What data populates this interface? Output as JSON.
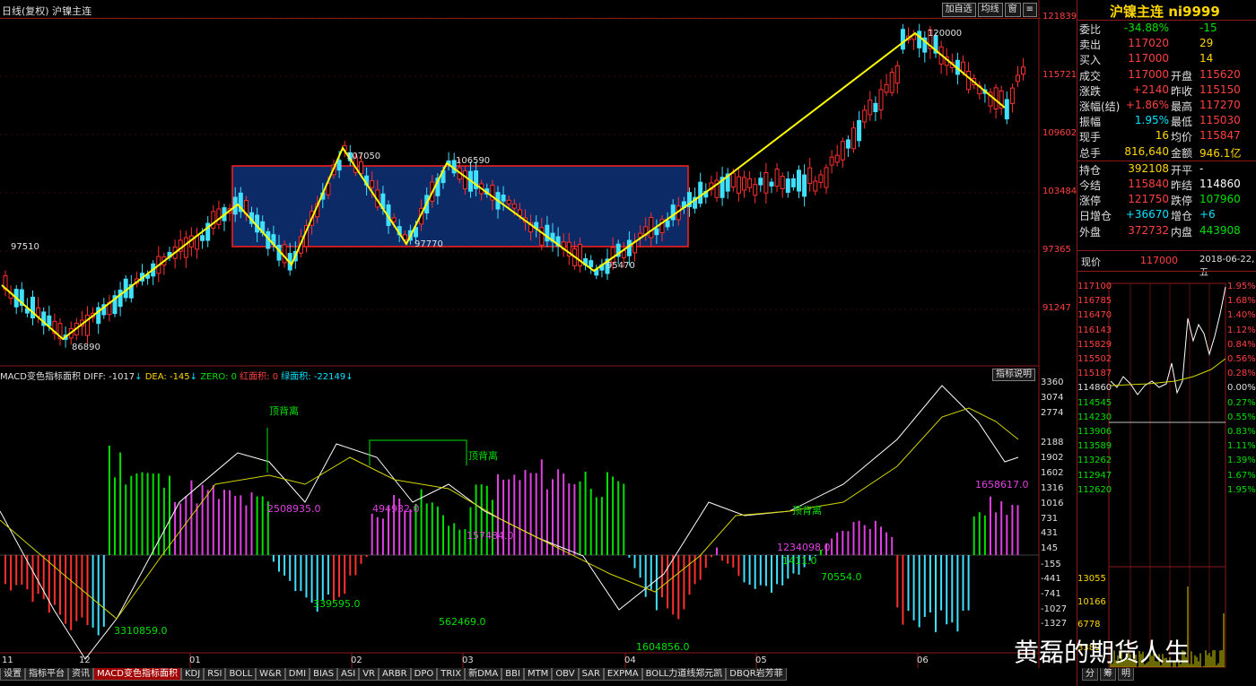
{
  "topbar": {
    "title": "日线(复权)  沪镍主连",
    "buttons": [
      "加自选",
      "均线",
      "窗",
      "≡"
    ]
  },
  "price_axis": [
    "121839",
    "115721",
    "109602",
    "103484",
    "97365",
    "91247"
  ],
  "price_annotations": [
    {
      "text": "97510"
    },
    {
      "text": "86890"
    },
    {
      "text": "107050"
    },
    {
      "text": "97770"
    },
    {
      "text": "106590"
    },
    {
      "text": "95470"
    },
    {
      "text": "120000"
    }
  ],
  "macd_header": {
    "name": "MACD变色指标面积",
    "diff": "DIFF: -1017",
    "dea": "DEA: -145",
    "zero": "ZERO: 0",
    "red_area": "红面积: 0",
    "green_area": "绿面积: -22149"
  },
  "macd_help_button": "指标说明",
  "macd_axis": [
    "3360",
    "3074",
    "2774",
    "2188",
    "1902",
    "1602",
    "1316",
    "1016",
    "731",
    "431",
    "145",
    "-155",
    "-441",
    "-741",
    "-1027",
    "-1327"
  ],
  "macd_labels": [
    {
      "text": "顶背离",
      "color": "#00e000"
    },
    {
      "text": "顶背离",
      "color": "#00e000"
    },
    {
      "text": "顶背离",
      "color": "#00e000"
    },
    {
      "text": "2508935.0",
      "color": "#e040e0"
    },
    {
      "text": "494932.0",
      "color": "#e040e0"
    },
    {
      "text": "157484.0",
      "color": "#e040e0"
    },
    {
      "text": "1658617.0",
      "color": "#e040e0"
    },
    {
      "text": "1234098.0",
      "color": "#e040e0"
    },
    {
      "text": "1411.0",
      "color": "#00e000"
    },
    {
      "text": "70554.0",
      "color": "#00e000"
    },
    {
      "text": "339595.0",
      "color": "#00e000"
    },
    {
      "text": "562469.0",
      "color": "#00e000"
    },
    {
      "text": "1604856.0",
      "color": "#00e000"
    },
    {
      "text": "3310859.0",
      "color": "#00e000"
    }
  ],
  "months": [
    "11",
    "12",
    "01",
    "02",
    "03",
    "04",
    "05",
    "06"
  ],
  "tabs": [
    "设置",
    "指标平台",
    "资讯",
    "MACD变色指标面积",
    "KDJ",
    "RSI",
    "BOLL",
    "W&R",
    "DMI",
    "BIAS",
    "ASI",
    "VR",
    "ARBR",
    "DPO",
    "TRIX",
    "新DMA",
    "BBI",
    "MTM",
    "OBV",
    "SAR",
    "EXPMA",
    "BOLL力道线郑元凯",
    "DBQR岩芳菲"
  ],
  "active_tab": "MACD变色指标面积",
  "quote": {
    "title": "沪镍主连 ni9999",
    "rows": [
      {
        "l1": "委比",
        "v1": "-34.88%",
        "c1": "grn",
        "l2": "",
        "v2": "-15",
        "c2": "grn"
      },
      {
        "l1": "卖出",
        "v1": "117020",
        "c1": "red",
        "l2": "",
        "v2": "29",
        "c2": "yel"
      },
      {
        "l1": "买入",
        "v1": "117000",
        "c1": "red",
        "l2": "",
        "v2": "14",
        "c2": "yel"
      },
      {
        "l1": "成交",
        "v1": "117000",
        "c1": "red",
        "l2": "开盘",
        "v2": "115620",
        "c2": "red"
      },
      {
        "l1": "涨跌",
        "v1": "+2140",
        "c1": "red",
        "l2": "昨收",
        "v2": "115150",
        "c2": "red"
      },
      {
        "l1": "涨幅(结)",
        "v1": "+1.86%",
        "c1": "red",
        "l2": "最高",
        "v2": "117270",
        "c2": "red"
      },
      {
        "l1": "振幅",
        "v1": "1.95%",
        "c1": "cyan",
        "l2": "最低",
        "v2": "115030",
        "c2": "red"
      },
      {
        "l1": "现手",
        "v1": "16",
        "c1": "yel",
        "l2": "均价",
        "v2": "115847",
        "c2": "red"
      },
      {
        "l1": "总手",
        "v1": "816,640",
        "c1": "yel",
        "l2": "金额",
        "v2": "946.1亿",
        "c2": "yel"
      },
      {
        "l1": "持仓",
        "v1": "392108",
        "c1": "yel",
        "l2": "开平",
        "v2": "-",
        "c2": "wht"
      },
      {
        "l1": "今结",
        "v1": "115840",
        "c1": "red",
        "l2": "昨结",
        "v2": "114860",
        "c2": "wht"
      },
      {
        "l1": "涨停",
        "v1": "121750",
        "c1": "red",
        "l2": "跌停",
        "v2": "107960",
        "c2": "grn"
      },
      {
        "l1": "日增仓",
        "v1": "+36670",
        "c1": "cyan",
        "l2": "增仓",
        "v2": "+6",
        "c2": "cyan"
      },
      {
        "l1": "外盘",
        "v1": "372732",
        "c1": "red",
        "l2": "内盘",
        "v2": "443908",
        "c2": "grn"
      }
    ],
    "current_label": "现价",
    "current_value": "117000",
    "date": "2018-06-22,五"
  },
  "intraday": {
    "left_ticks": [
      "117100",
      "116785",
      "116470",
      "116143",
      "115829",
      "115502",
      "115187",
      "114860",
      "114545",
      "114230",
      "113906",
      "113589",
      "113262",
      "112947",
      "112620",
      "13055",
      "10166",
      "6778",
      "3389"
    ],
    "right_ticks": [
      "1.95%",
      "1.68%",
      "1.40%",
      "1.12%",
      "0.84%",
      "0.56%",
      "0.28%",
      "0.00%",
      "0.27%",
      "0.55%",
      "0.83%",
      "1.11%",
      "1.39%",
      "1.67%",
      "1.95%"
    ],
    "bottom_buttons": [
      "分",
      "筹",
      "明"
    ]
  },
  "watermark": "黄磊的期货人生"
}
